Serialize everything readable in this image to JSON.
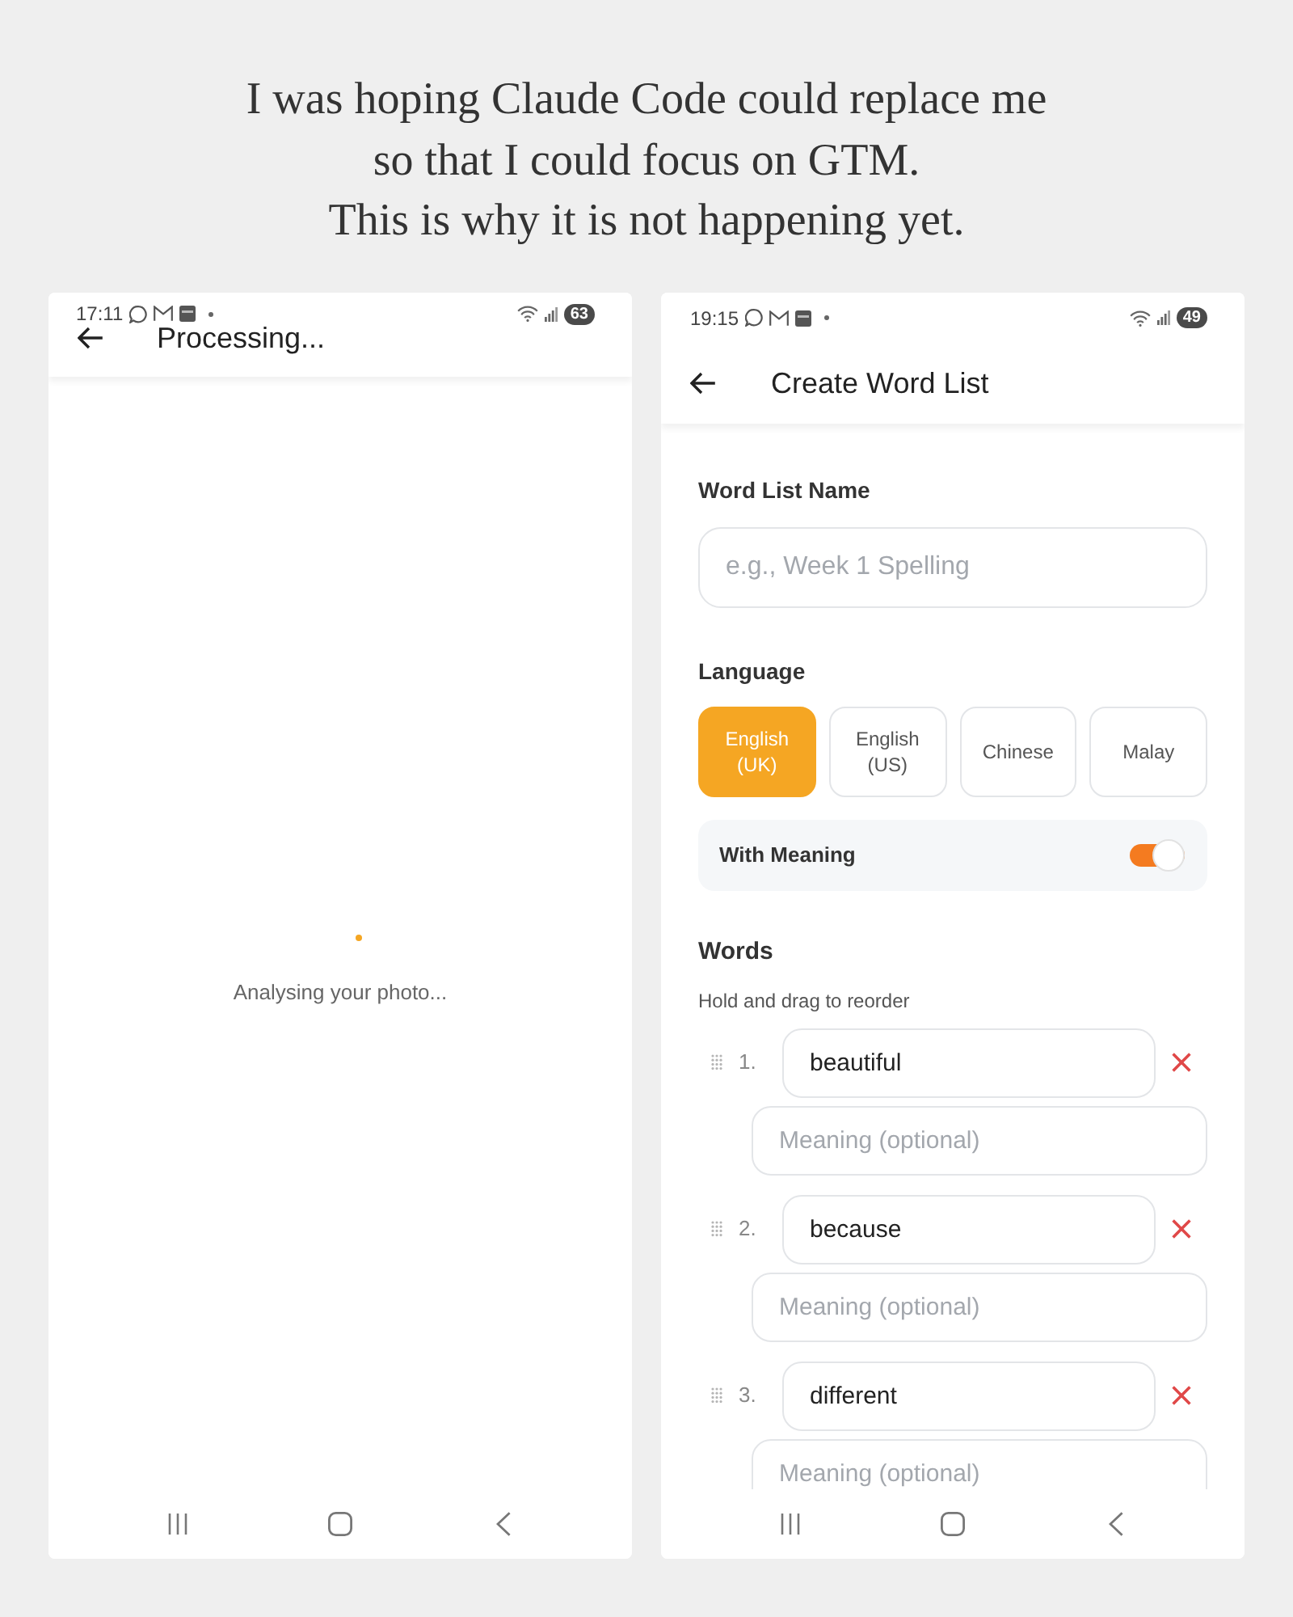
{
  "caption": {
    "lines": [
      "I was hoping Claude Code could replace me",
      "so that I could focus on GTM.",
      "This is why it is not happening yet."
    ]
  },
  "screens": [
    {
      "kind": "processing",
      "status_bar": {
        "time": "17:11",
        "battery": "63"
      },
      "header": {
        "title": "Processing..."
      },
      "message": "Analysing your photo..."
    },
    {
      "kind": "form",
      "status_bar": {
        "time": "19:15",
        "battery": "49"
      },
      "header": {
        "title": "Create Word List"
      },
      "name_section": {
        "label": "Word List Name",
        "field": {
          "placeholder": "e.g., Week 1 Spelling"
        }
      },
      "language_section": {
        "label": "Language",
        "options": [
          {
            "label": "English (UK)",
            "selected": true
          },
          {
            "label": "English (US)",
            "selected": false
          },
          {
            "label": "Chinese",
            "selected": false
          },
          {
            "label": "Malay",
            "selected": false
          }
        ]
      },
      "with_meaning": {
        "label": "With Meaning",
        "on": true
      },
      "words_section": {
        "label": "Words",
        "hint": "Hold and drag to reorder",
        "items": [
          {
            "number": "1.",
            "word": "beautiful",
            "meaning": {
              "placeholder": "Meaning (optional)"
            }
          },
          {
            "number": "2.",
            "word": "because",
            "meaning": {
              "placeholder": "Meaning (optional)"
            }
          },
          {
            "number": "3.",
            "word": "different",
            "meaning": {
              "placeholder": "Meaning (optional)"
            }
          }
        ]
      }
    }
  ]
}
